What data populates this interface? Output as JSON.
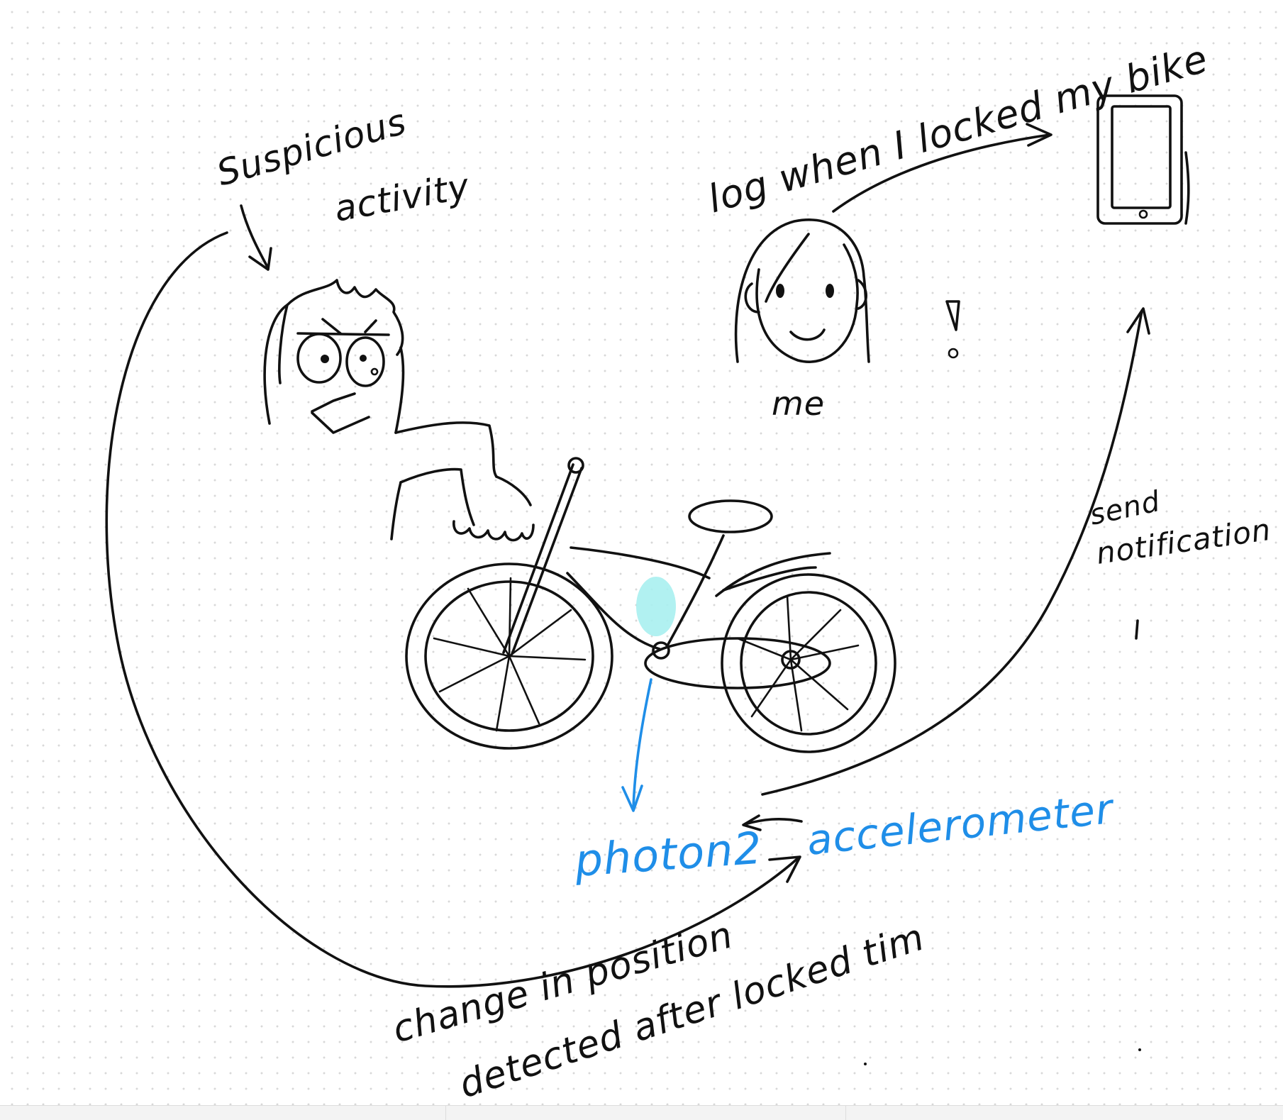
{
  "labels": {
    "suspicious_line1": "Suspicious",
    "suspicious_line2": "activity",
    "log_line": "log when I locked my bike",
    "me": "me",
    "exclamation": "!",
    "send_line1": "send",
    "send_line2": "notification",
    "photon": "photon2",
    "accelerometer": "accelerometer",
    "change_line1": "change in position",
    "change_line2": "detected after locked tim"
  },
  "colors": {
    "ink": "#111111",
    "highlight_ink": "#1f8ee8",
    "sensor_fill": "#a8f0f0",
    "grid_dot": "#d8d8d8"
  }
}
